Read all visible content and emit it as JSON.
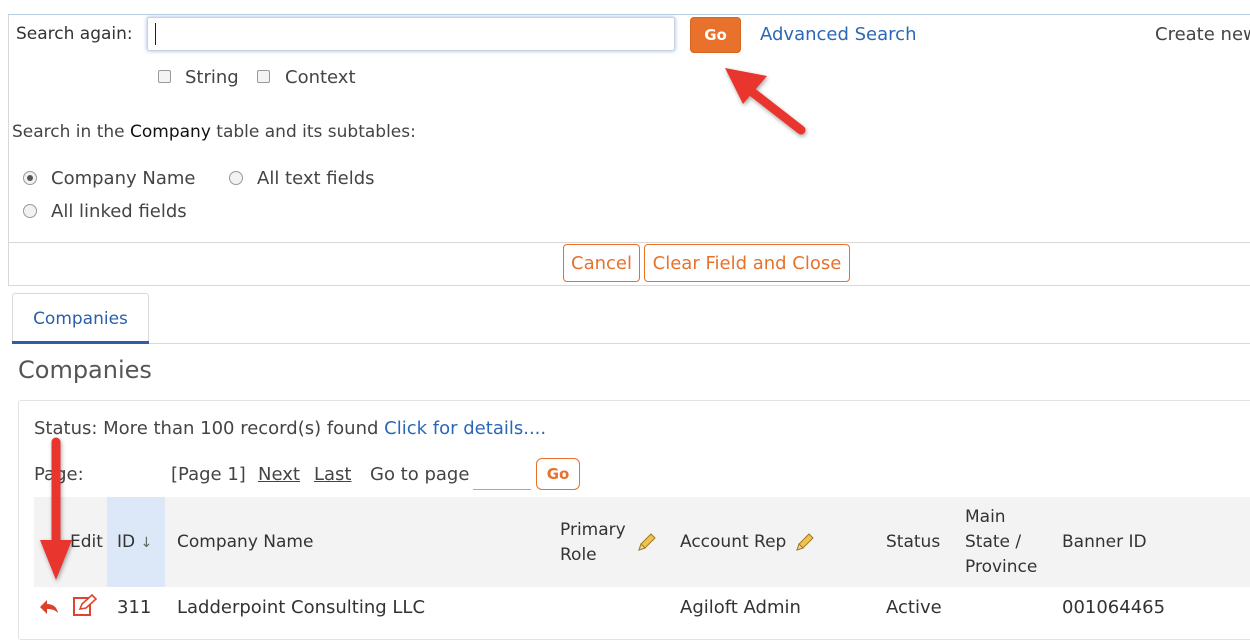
{
  "search": {
    "label": "Search again:",
    "value": "",
    "go_label": "Go",
    "advanced_label": "Advanced Search",
    "create_new_label": "Create new",
    "options": [
      {
        "label": "String",
        "checked": false
      },
      {
        "label": "Context",
        "checked": false
      }
    ],
    "scope_prefix": "Search in the ",
    "scope_table": "Company",
    "scope_suffix": " table and its subtables:",
    "radios": [
      {
        "label": "Company Name",
        "selected": true
      },
      {
        "label": "All text fields",
        "selected": false
      },
      {
        "label": "All linked fields",
        "selected": false
      }
    ],
    "cancel_label": "Cancel",
    "clear_close_label": "Clear Field and Close"
  },
  "tabs": [
    {
      "label": "Companies",
      "active": true
    }
  ],
  "section_title": "Companies",
  "results": {
    "status_text": "Status: More than 100 record(s) found",
    "details_link": "Click for details....",
    "page_label": "Page:",
    "page_current": "[Page 1]",
    "next_label": "Next",
    "last_label": "Last",
    "goto_label": "Go to page",
    "goto_value": "",
    "go_label": "Go",
    "columns": {
      "edit": "Edit",
      "id": "ID",
      "company_name": "Company Name",
      "primary_role_1": "Primary",
      "primary_role_2": "Role",
      "account_rep": "Account Rep",
      "status": "Status",
      "state_1": "Main",
      "state_2": "State /",
      "state_3": "Province",
      "banner_id": "Banner ID"
    },
    "rows": [
      {
        "id": "311",
        "company_name": "Ladderpoint Consulting LLC",
        "primary_role": "",
        "account_rep": "Agiloft Admin",
        "status": "Active",
        "state": "",
        "banner_id": "001064465"
      }
    ]
  },
  "colors": {
    "accent_orange": "#e8712b",
    "link_blue": "#2b67b8",
    "annotation_red": "#e8352f"
  }
}
